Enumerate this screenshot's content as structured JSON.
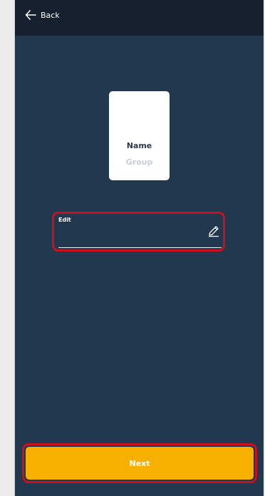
{
  "header": {
    "back_label": "Back",
    "back_icon": "arrow-left-icon"
  },
  "card": {
    "name": "Name",
    "group": "Group"
  },
  "edit_field": {
    "label": "Edit",
    "value": "",
    "icon": "pencil-icon"
  },
  "footer": {
    "next_label": "Next"
  },
  "colors": {
    "background": "#22384f",
    "topbar": "#17202e",
    "accent": "#f8b000",
    "highlight": "#c8101e"
  }
}
